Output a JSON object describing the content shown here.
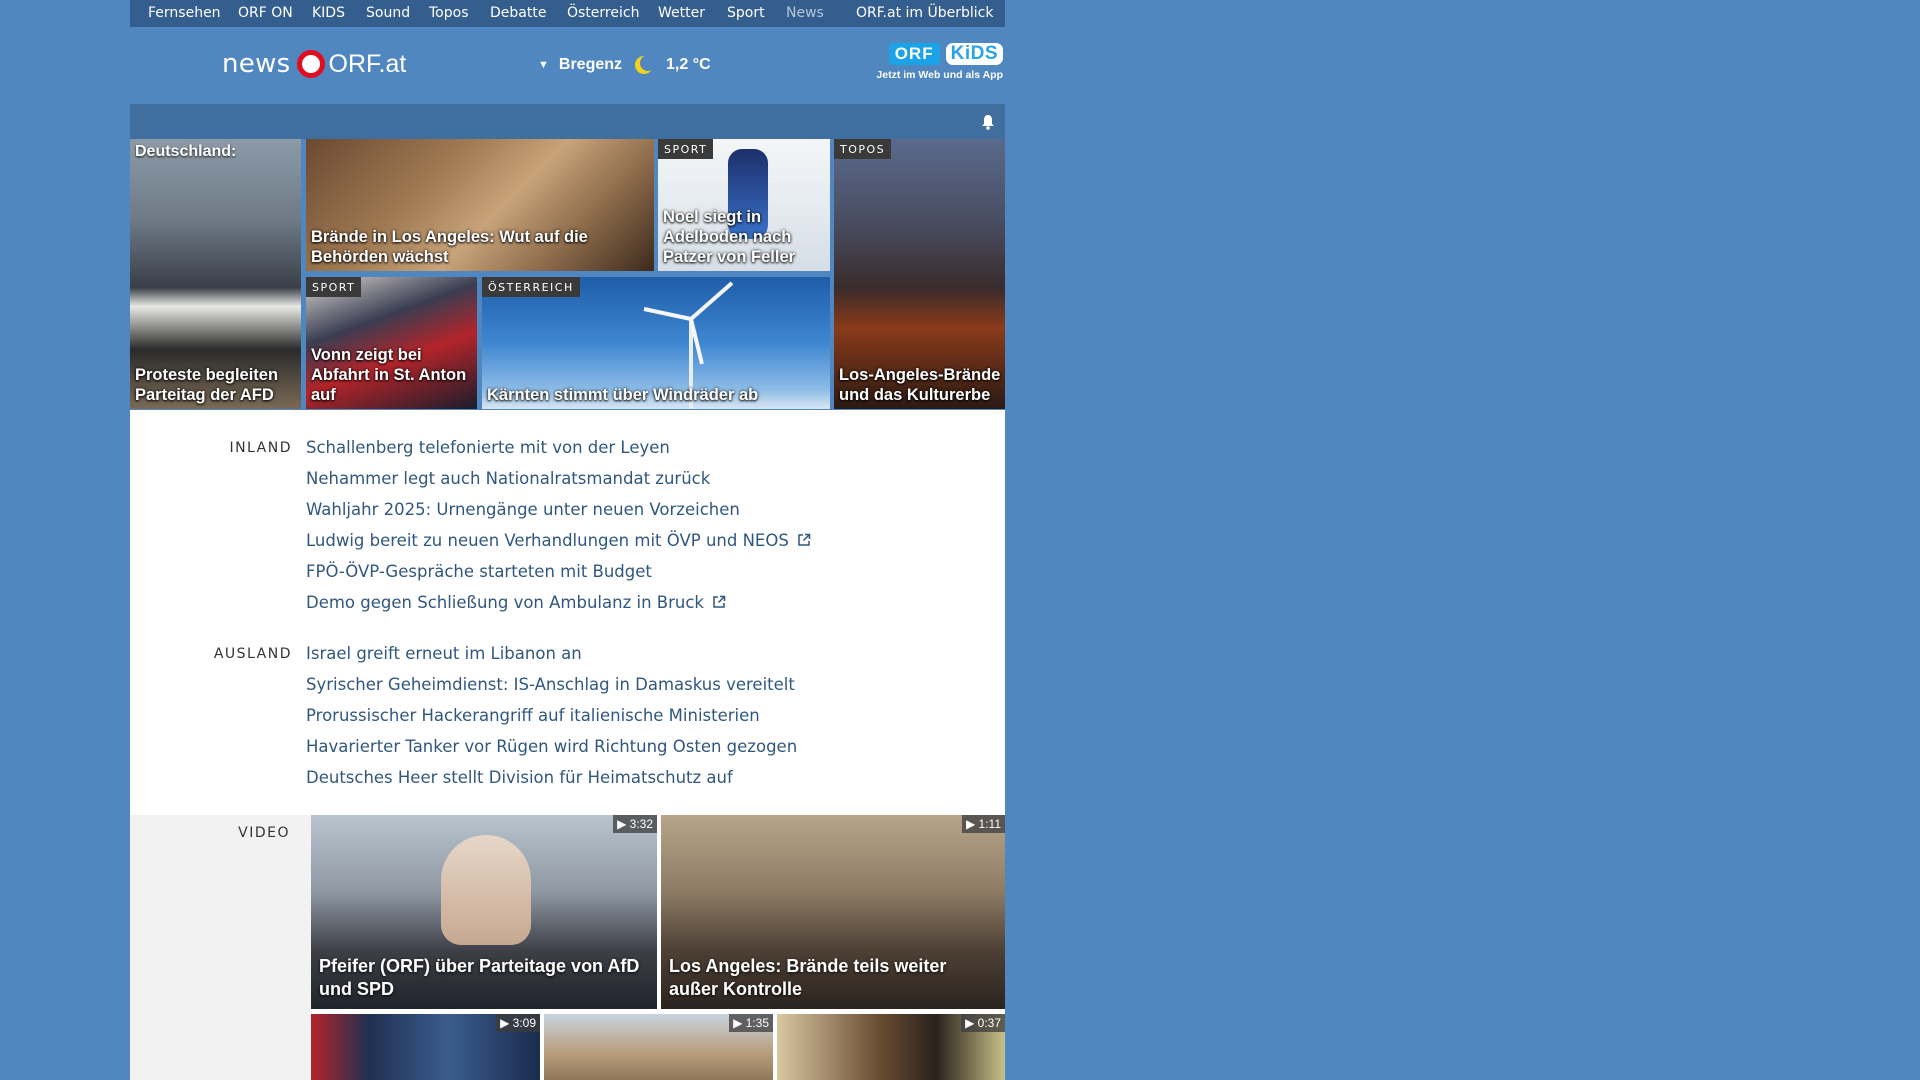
{
  "nav": {
    "items": [
      "Fernsehen",
      "ORF ON",
      "KIDS",
      "Sound",
      "Topos",
      "Debatte",
      "Österreich",
      "Wetter",
      "Sport",
      "News",
      "ORF.at im Überblick"
    ],
    "active": "News"
  },
  "header": {
    "logo_news": "news",
    "logo_orf": "ORF.at",
    "weather": {
      "city": "Bregenz",
      "temp": "1,2 °C",
      "icon": "moon-icon"
    },
    "kids": {
      "badge1": "ORF",
      "badge2": "KiDS",
      "subline": "Jetzt im Web und als App"
    }
  },
  "teasers": [
    {
      "caption_top": "Deutschland:",
      "caption": "Proteste begleiten Parteitag der AFD",
      "tag": ""
    },
    {
      "caption": "Brände in Los Angeles: Wut auf die Behörden wächst",
      "tag": ""
    },
    {
      "caption": "Noel siegt in Adelboden nach Patzer von Feller",
      "tag": "SPORT"
    },
    {
      "caption": "Los-Angeles-Brände und das Kulturerbe",
      "tag": "TOPOS"
    },
    {
      "caption": "Vonn zeigt bei Abfahrt in St. Anton auf",
      "tag": "SPORT"
    },
    {
      "caption": "Kärnten stimmt über Windräder ab",
      "tag": "ÖSTERREICH"
    }
  ],
  "sections": {
    "inland": {
      "label": "INLAND",
      "links": [
        "Schallenberg telefonierte mit von der Leyen",
        "Nehammer legt auch Nationalratsmandat zurück",
        "Wahljahr 2025: Urnengänge unter neuen Vorzeichen",
        "Ludwig bereit zu neuen Verhandlungen mit ÖVP und NEOS",
        "FPÖ-ÖVP-Gespräche starteten mit Budget",
        "Demo gegen Schließung von Ambulanz in Bruck"
      ]
    },
    "ausland": {
      "label": "AUSLAND",
      "links": [
        "Israel greift erneut im Libanon an",
        "Syrischer Geheimdienst: IS-Anschlag in Damaskus vereitelt",
        "Prorussischer Hackerangriff auf italienische Ministerien",
        "Havarierter Tanker vor Rügen wird Richtung Osten gezogen",
        "Deutsches Heer stellt Division für Heimatschutz auf"
      ]
    }
  },
  "video": {
    "label": "VIDEO",
    "items": [
      {
        "caption": "Pfeifer (ORF) über Parteitage von AfD und SPD",
        "duration": "▶ 3:32"
      },
      {
        "caption": "Los Angeles: Brände teils weiter außer Kontrolle",
        "duration": "▶ 1:11"
      },
      {
        "caption": "",
        "duration": "▶ 3:09"
      },
      {
        "caption": "",
        "duration": "▶ 1:35"
      },
      {
        "caption": "",
        "duration": "▶ 0:37"
      }
    ]
  },
  "colors": {
    "page_bg": "#5087c0",
    "nav_bg": "#345e8d",
    "link": "#31577f",
    "logo_red": "#e20e1f"
  }
}
